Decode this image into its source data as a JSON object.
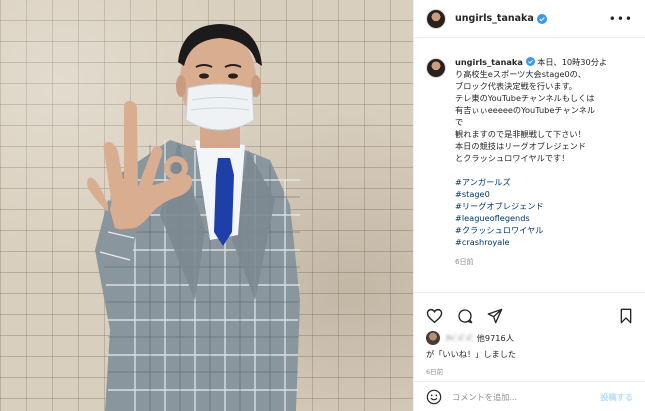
{
  "post": {
    "username": "ungirls_tanaka",
    "more_icon": "more-horizontal-icon"
  },
  "caption": {
    "username": "ungirls_tanaka",
    "lines": [
      "本日、10時30分よ",
      "り高校生eスポーツ大会stage0の、",
      "ブロック代表決定戦を行います。",
      "テレ東のYouTubeチャンネルもしくは",
      "有吉ぃぃeeeeeのYouTubeチャンネル",
      "で",
      "観れますので是非観戦して下さい！",
      "本日の競技はリーグオブレジェンド",
      "とクラッシュロワイヤルです！"
    ],
    "hashtags": [
      "#アンガールズ",
      "#stage0",
      "#リーグオブレジェンド",
      "#leagueoflegends",
      "#クラッシュロワイヤル",
      "#crashroyale"
    ],
    "time_ago": "6日前"
  },
  "actions": {
    "likes_prefix": "ﾅﾍﾞﾊﾟﾊﾟ",
    "likes_count": "他9716人",
    "likes_suffix": "が「いいね！」しました",
    "post_date": "6日前"
  },
  "comment": {
    "placeholder": "コメントを追加...",
    "post_label": "投稿する"
  },
  "colors": {
    "hashtag": "#00376b",
    "verified": "#3897f0",
    "post_disabled": "#b2dffc",
    "text": "#262626",
    "muted": "#8e8e8e"
  }
}
